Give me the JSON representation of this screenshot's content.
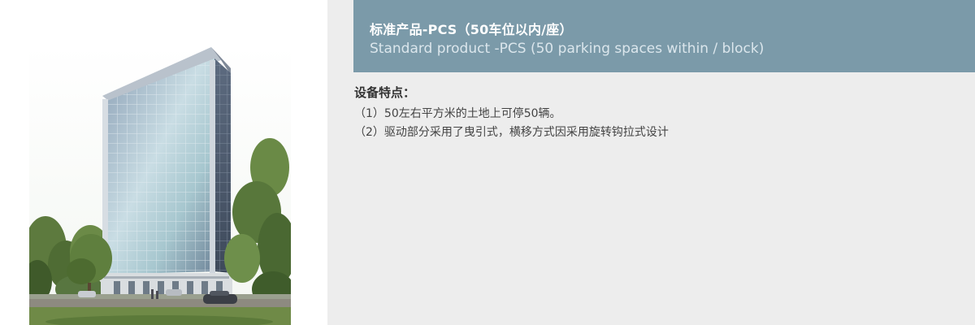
{
  "colors": {
    "title_bar_bg": "#7b9aa9",
    "right_panel_bg": "#ededed",
    "title_cn_color": "#ffffff",
    "title_en_color": "#dbe6ec"
  },
  "product": {
    "title_cn": "标准产品-PCS（50车位以内/座）",
    "title_en": "Standard product -PCS (50 parking spaces within / block)"
  },
  "features": {
    "heading": "设备特点：",
    "items": [
      "（1）50左右平方米的土地上可停50辆。",
      "（2）驱动部分采用了曳引式，横移方式因采用旋转钩拉式设计"
    ]
  }
}
